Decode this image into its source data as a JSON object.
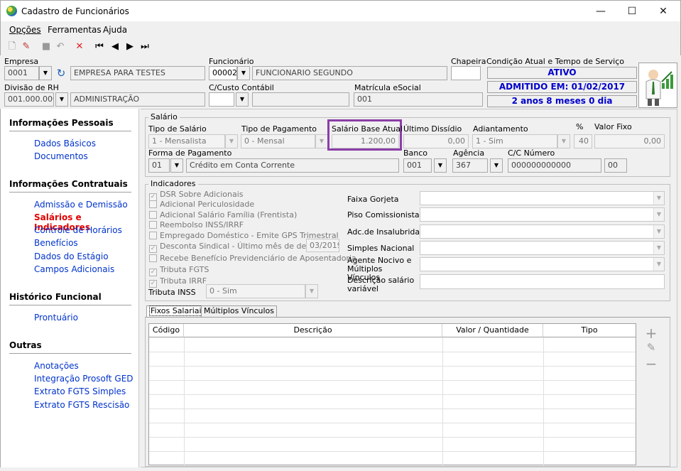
{
  "window": {
    "title": "Cadastro de Funcionários",
    "controls": {
      "minimize": "—",
      "maximize": "☐",
      "close": "✕"
    }
  },
  "menu": [
    {
      "label": "Opções"
    },
    {
      "label": "Ferramentas"
    },
    {
      "label": "Ajuda"
    }
  ],
  "toolbar": {
    "icons": [
      "new-icon",
      "edit-icon",
      "save-icon",
      "undo-icon",
      "delete-icon",
      "first-record-icon",
      "previous-record-icon",
      "next-record-icon",
      "last-record-icon"
    ]
  },
  "header": {
    "empresa": {
      "label": "Empresa",
      "code": "0001",
      "name": "EMPRESA PARA TESTES"
    },
    "funcionario": {
      "label": "Funcionário",
      "code": "00002",
      "name": "FUNCIONARIO SEGUNDO"
    },
    "chapeira": {
      "label": "Chapeira",
      "value": ""
    },
    "condicao": {
      "label": "Condição Atual e Tempo de Serviço",
      "status": "ATIVO",
      "admitido": "ADMITIDO EM: 01/02/2017",
      "tempo": "2 anos 8 meses 0 dia"
    },
    "divisao": {
      "label": "Divisão de RH",
      "code": "001.000.000",
      "name": "ADMINISTRAÇÃO"
    },
    "custo": {
      "label": "C/Custo Contábil",
      "code": "",
      "name": ""
    },
    "matricula": {
      "label": "Matrícula eSocial",
      "value": "001"
    }
  },
  "sidebar": {
    "sections": [
      {
        "title": "Informações Pessoais",
        "items": [
          "Dados Básicos",
          "Documentos"
        ]
      },
      {
        "title": "Informações Contratuais",
        "items": [
          "Admissão e Demissão",
          "Salários e Indicadores",
          "Controle de Horários",
          "Benefícios",
          "Dados do Estágio",
          "Campos Adicionais"
        ]
      },
      {
        "title": "Histórico Funcional",
        "items": [
          "Prontuário"
        ]
      },
      {
        "title": "Outras",
        "items": [
          "Anotações",
          "Integração Prosoft GED",
          "Extrato FGTS Simples",
          "Extrato FGTS Rescisão"
        ]
      }
    ],
    "active": "Salários e Indicadores"
  },
  "salario": {
    "group_title": "Salário",
    "tipo_salario": {
      "label": "Tipo de Salário",
      "value": "1 - Mensalista"
    },
    "tipo_pagamento": {
      "label": "Tipo de Pagamento",
      "value": "0 - Mensal"
    },
    "salario_base": {
      "label": "Salário Base Atual",
      "value": "1.200,00",
      "highlight": "#8b3ea8"
    },
    "ultimo_dissidio": {
      "label": "Último Dissídio",
      "value": "0,00"
    },
    "adiantamento": {
      "label": "Adiantamento",
      "value": "1 - Sim"
    },
    "percent": {
      "label": "%",
      "value": "40"
    },
    "valor_fixo": {
      "label": "Valor Fixo",
      "value": "0,00"
    },
    "forma_pagamento": {
      "label": "Forma de Pagamento",
      "code": "01",
      "name": "Crédito em Conta Corrente"
    },
    "banco": {
      "label": "Banco",
      "value": "001"
    },
    "agencia": {
      "label": "Agência",
      "value": "367"
    },
    "cc": {
      "label": "C/C Número",
      "value": "000000000000",
      "digit": "00"
    }
  },
  "indicadores": {
    "group_title": "Indicadores",
    "checks": [
      {
        "label": "DSR Sobre Adicionais",
        "checked": true
      },
      {
        "label": "Adicional Periculosidade",
        "checked": false
      },
      {
        "label": "Adicional Salário Família (Frentista)",
        "checked": false
      },
      {
        "label": "Reembolso INSS/IRRF",
        "checked": false
      },
      {
        "label": "Empregado Doméstico - Emite GPS Trimestral",
        "checked": false
      },
      {
        "label": "Desconta Sindical - Último mês de desconto",
        "checked": true
      },
      {
        "label": "Recebe Benefício Previdenciário de Aposentadoria",
        "checked": false
      },
      {
        "label": "Tributa FGTS",
        "checked": true
      },
      {
        "label": "Tributa IRRF",
        "checked": true
      }
    ],
    "sindical_mes": "03/2019",
    "tributa_inss": {
      "label": "Tributa INSS",
      "value": "0 - Sim"
    },
    "right": [
      {
        "label": "Faixa Gorjeta"
      },
      {
        "label": "Piso Comissionista"
      },
      {
        "label": "Adc.de Insalubridade"
      },
      {
        "label": "Simples Nacional"
      },
      {
        "label": "Agente Nocivo e Múltiplos Vínculos"
      },
      {
        "label": "Descrição salário variável"
      }
    ]
  },
  "tabs": [
    {
      "label": "Fixos Salariais"
    },
    {
      "label": "Múltiplos Vínculos"
    }
  ],
  "grid": {
    "columns": [
      "Código",
      "Descrição",
      "Valor / Quantidade",
      "Tipo"
    ]
  }
}
